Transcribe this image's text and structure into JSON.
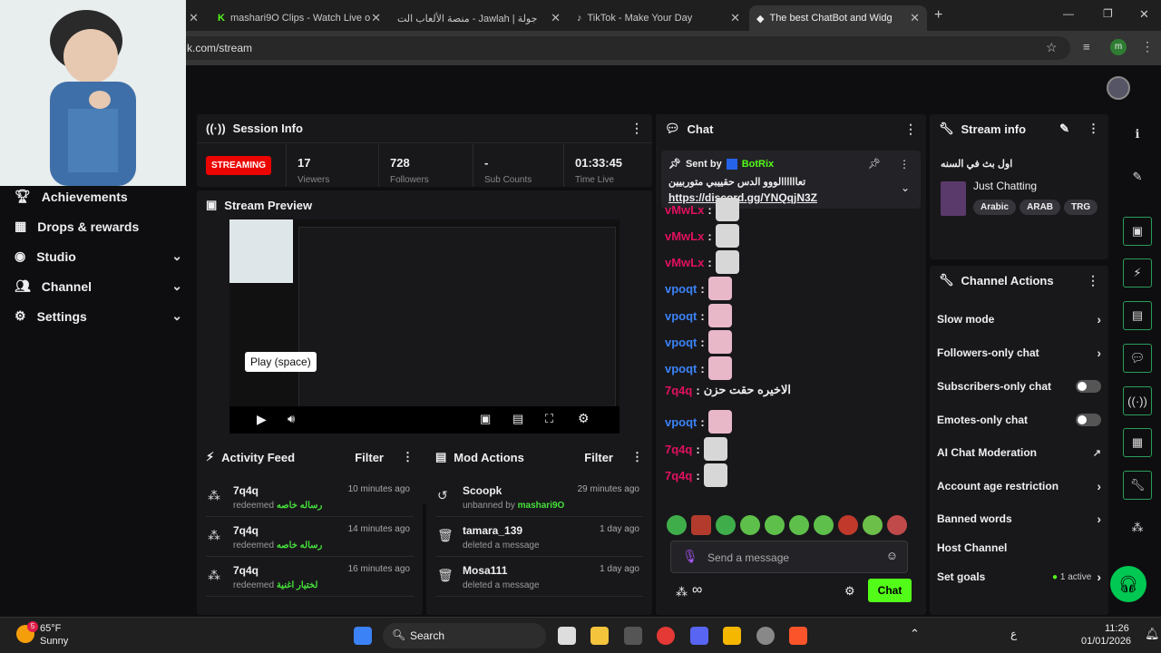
{
  "browser": {
    "tabs": [
      {
        "title": "mashari9O Clips - Watch Live o"
      },
      {
        "title": "منصة الألعاب الت - Jawlah | جولة"
      },
      {
        "title": "TikTok - Make Your Day"
      },
      {
        "title": "The best ChatBot and Widg"
      }
    ],
    "url": "k.com/stream",
    "profile_initial": "m"
  },
  "sidebar": {
    "items": [
      {
        "label": "Achievements"
      },
      {
        "label": "Drops & rewards"
      },
      {
        "label": "Studio"
      },
      {
        "label": "Channel"
      },
      {
        "label": "Settings"
      }
    ]
  },
  "session": {
    "title": "Session Info",
    "status": "STREAMING",
    "stats": [
      {
        "value": "17",
        "label": "Viewers"
      },
      {
        "value": "728",
        "label": "Followers"
      },
      {
        "value": "-",
        "label": "Sub Counts"
      },
      {
        "value": "01:33:45",
        "label": "Time Live"
      }
    ]
  },
  "preview": {
    "title": "Stream Preview",
    "tooltip": "Play (space)"
  },
  "activity": {
    "title": "Activity Feed",
    "filter": "Filter",
    "rows": [
      {
        "name": "7q4q",
        "action": "redeemed",
        "reward": "رساله خاصه",
        "time": "10 minutes ago"
      },
      {
        "name": "7q4q",
        "action": "redeemed",
        "reward": "رساله خاصه",
        "time": "14 minutes ago"
      },
      {
        "name": "7q4q",
        "action": "redeemed",
        "reward": "لختيار اغنية",
        "time": "16 minutes ago"
      }
    ]
  },
  "mod": {
    "title": "Mod Actions",
    "filter": "Filter",
    "rows": [
      {
        "name": "Scoopk",
        "action": "unbanned by",
        "by": "mashari9O",
        "time": "29 minutes ago"
      },
      {
        "name": "tamara_139",
        "action": "deleted a message",
        "by": "",
        "time": "1 day ago"
      },
      {
        "name": "Mosa111",
        "action": "deleted a message",
        "by": "",
        "time": "1 day ago"
      }
    ]
  },
  "chat": {
    "title": "Chat",
    "pinned_by_label": "Sent by",
    "pinned_by": "BotRix",
    "pinned_text": "تعاااااالووو الدس حقييبي متوربيين",
    "pinned_link": "https://discord.gg/YNQqjN3Z",
    "messages": [
      {
        "user": "vMwLx",
        "color": "#e0115f"
      },
      {
        "user": "vMwLx",
        "color": "#e0115f"
      },
      {
        "user": "vMwLx",
        "color": "#e0115f"
      },
      {
        "user": "vpoqt",
        "color": "#3b82f6"
      },
      {
        "user": "vpoqt",
        "color": "#3b82f6"
      },
      {
        "user": "vpoqt",
        "color": "#3b82f6"
      },
      {
        "user": "vpoqt",
        "color": "#3b82f6"
      },
      {
        "user": "7q4q",
        "color": "#e0115f",
        "text": "الاخيره حقت حزن"
      },
      {
        "user": "vpoqt",
        "color": "#3b82f6"
      },
      {
        "user": "7q4q",
        "color": "#e0115f"
      },
      {
        "user": "7q4q",
        "color": "#e0115f"
      }
    ],
    "input_placeholder": "Send a message",
    "send_label": "Chat",
    "infinity": "∞"
  },
  "stream_info": {
    "title": "Stream info",
    "stream_title": "اول بث في السنه",
    "category": "Just Chatting",
    "tags": [
      "Arabic",
      "ARAB",
      "TRG"
    ]
  },
  "channel_actions": {
    "title": "Channel Actions",
    "items": [
      {
        "label": "Slow mode",
        "control": "chevron"
      },
      {
        "label": "Followers-only chat",
        "control": "chevron"
      },
      {
        "label": "Subscribers-only chat",
        "control": "toggle"
      },
      {
        "label": "Emotes-only chat",
        "control": "toggle"
      },
      {
        "label": "AI Chat Moderation",
        "control": "external"
      },
      {
        "label": "Account age restriction",
        "control": "chevron"
      },
      {
        "label": "Banned words",
        "control": "chevron"
      },
      {
        "label": "Host Channel",
        "control": "none"
      },
      {
        "label": "Set goals",
        "control": "chevron",
        "badge": "1 active"
      }
    ]
  },
  "taskbar": {
    "weather_temp": "65°F",
    "weather_desc": "Sunny",
    "weather_badge": "5",
    "search": "Search",
    "lang": "ع",
    "time": "11:26",
    "date": "01/01/2026"
  },
  "colors": {
    "accent": "#53fc18",
    "streaming": "#eb0400",
    "link": "#fff"
  }
}
